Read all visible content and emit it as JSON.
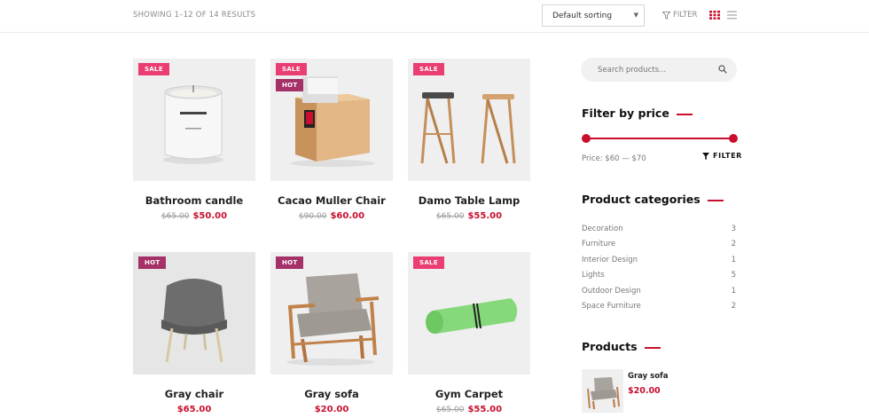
{
  "toolbar": {
    "result_count": "SHOWING 1–12 OF 14 RESULTS",
    "sort_value": "Default sorting",
    "filter_label": "FILTER"
  },
  "products": [
    {
      "name": "Bathroom candle",
      "old_price": "$65.00",
      "price": "$50.00",
      "badges": [
        "SALE"
      ]
    },
    {
      "name": "Cacao Muller Chair",
      "old_price": "$90.00",
      "price": "$60.00",
      "badges": [
        "SALE",
        "HOT"
      ]
    },
    {
      "name": "Damo Table Lamp",
      "old_price": "$65.00",
      "price": "$55.00",
      "badges": [
        "SALE"
      ]
    },
    {
      "name": "Gray chair",
      "old_price": "",
      "price": "$65.00",
      "badges": [
        "HOT"
      ]
    },
    {
      "name": "Gray sofa",
      "old_price": "",
      "price": "$20.00",
      "badges": [
        "HOT"
      ]
    },
    {
      "name": "Gym Carpet",
      "old_price": "$65.00",
      "price": "$55.00",
      "badges": [
        "SALE"
      ]
    }
  ],
  "sidebar": {
    "search_placeholder": "Search products...",
    "filter_title": "Filter by price",
    "price_range_label": "Price: $60 — $70",
    "filter_button": "FILTER",
    "categories_title": "Product categories",
    "categories": [
      {
        "name": "Decoration",
        "count": "3"
      },
      {
        "name": "Furniture",
        "count": "2"
      },
      {
        "name": "Interior Design",
        "count": "1"
      },
      {
        "name": "Lights",
        "count": "5"
      },
      {
        "name": "Outdoor Design",
        "count": "1"
      },
      {
        "name": "Space Furniture",
        "count": "2"
      }
    ],
    "products_title": "Products",
    "mini_products": [
      {
        "name": "Gray sofa",
        "price": "$20.00"
      }
    ]
  },
  "colors": {
    "accent": "#c8102e",
    "sale_badge": "#ea3e73",
    "hot_badge": "#a43167"
  },
  "icons": [
    "chevron-down-icon",
    "funnel-icon",
    "grid-view-icon",
    "list-view-icon",
    "search-icon"
  ]
}
